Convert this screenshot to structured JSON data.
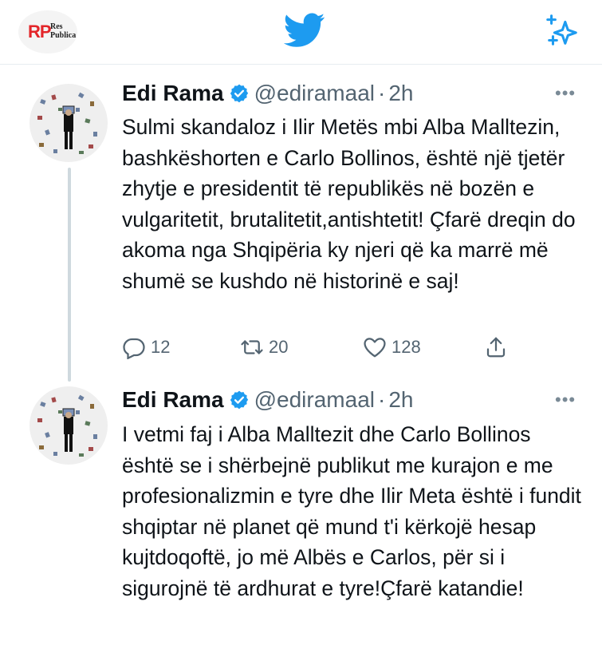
{
  "header": {
    "logo_letters": "RP",
    "logo_text_line1": "Res",
    "logo_text_line2": "Publica",
    "center_icon": "twitter-bird-icon",
    "right_icon": "sparkle-icon",
    "brand_color": "#1d9bf0",
    "logo_color": "#e3262a"
  },
  "tweets": [
    {
      "name": "Edi Rama",
      "handle": "@ediramaal",
      "separator": "·",
      "time": "2h",
      "text": "Sulmi skandaloz i Ilir Metës mbi Alba Malltezin, bashkëshorten e Carlo Bollinos, është një tjetër zhytje e presidentit të republikës në bozën e vulgaritetit, brutalitetit,antishtetit! Çfarë dreqin do akoma nga Shqipëria ky njeri që ka marrë më shumë se kushdo në historinë e saj!",
      "replies": "12",
      "retweets": "20",
      "likes": "128"
    },
    {
      "name": "Edi Rama",
      "handle": "@ediramaal",
      "separator": "·",
      "time": "2h",
      "text": "I vetmi faj i Alba Malltezit dhe Carlo Bollinos është se i shërbejnë publikut me kurajon e me profesionalizmin e tyre dhe Ilir Meta është i fundit shqiptar në planet që mund t'i kërkojë hesap kujtdoqoftë, jo më Albës e Carlos, për si i sigurojnë të ardhurat e tyre!Çfarë katandie!"
    }
  ],
  "more_label": "•••",
  "verified_color": "#1d9bf0",
  "muted_color": "#536471"
}
